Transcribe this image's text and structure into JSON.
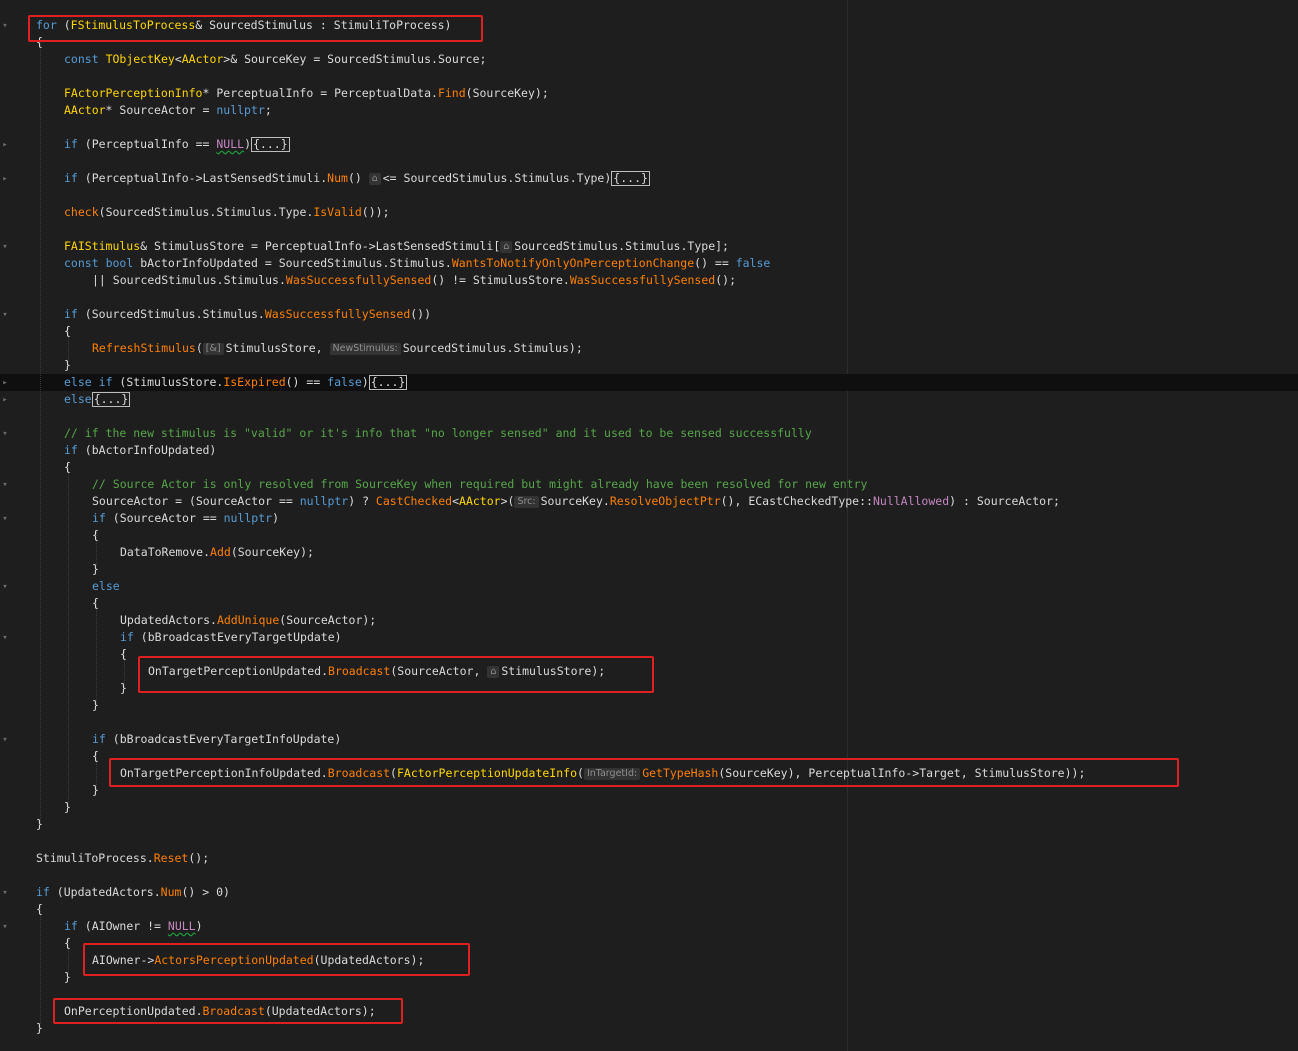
{
  "editor": {
    "language": "cpp",
    "hint_glyph": "⌂",
    "collapsed_block": "{...}"
  },
  "code": {
    "l1": [
      "for",
      " (",
      "FStimulusToProcess",
      "& ",
      "SourcedStimulus",
      " : ",
      "StimuliToProcess",
      ")"
    ],
    "l2": "{",
    "l3": [
      "const",
      " ",
      "TObjectKey",
      "<",
      "AActor",
      ">& ",
      "SourceKey",
      " = ",
      "SourcedStimulus",
      ".",
      "Source",
      ";"
    ],
    "l4": [
      "FActorPerceptionInfo",
      "* ",
      "PerceptualInfo",
      " = ",
      "PerceptualData",
      ".",
      "Find",
      "(",
      "SourceKey",
      ");"
    ],
    "l5": [
      "AActor",
      "* ",
      "SourceActor",
      " = ",
      "nullptr",
      ";"
    ],
    "l6": [
      "if",
      " (",
      "PerceptualInfo",
      " == ",
      "NULL",
      ")"
    ],
    "l7": [
      "if",
      " (",
      "PerceptualInfo",
      "->",
      "LastSensedStimuli",
      ".",
      "Num",
      "() ",
      "<= ",
      "SourcedStimulus",
      ".",
      "Stimulus",
      ".",
      "Type",
      ")"
    ],
    "l8": [
      "check",
      "(",
      "SourcedStimulus",
      ".",
      "Stimulus",
      ".",
      "Type",
      ".",
      "IsValid",
      "());"
    ],
    "l9": [
      "FAIStimulus",
      "& ",
      "StimulusStore",
      " = ",
      "PerceptualInfo",
      "->",
      "LastSensedStimuli",
      "[",
      "SourcedStimulus",
      ".",
      "Stimulus",
      ".",
      "Type",
      "];"
    ],
    "l10": [
      "const",
      " ",
      "bool",
      " ",
      "bActorInfoUpdated",
      " = ",
      "SourcedStimulus",
      ".",
      "Stimulus",
      ".",
      "WantsToNotifyOnlyOnPerceptionChange",
      "() == ",
      "false"
    ],
    "l11": [
      "|| ",
      "SourcedStimulus",
      ".",
      "Stimulus",
      ".",
      "WasSuccessfullySensed",
      "() != ",
      "StimulusStore",
      ".",
      "WasSuccessfullySensed",
      "();"
    ],
    "l12": [
      "if",
      " (",
      "SourcedStimulus",
      ".",
      "Stimulus",
      ".",
      "WasSuccessfullySensed",
      "())"
    ],
    "l13": "{",
    "l14": [
      "RefreshStimulus",
      "(",
      "[&]",
      "StimulusStore",
      ", ",
      "NewStimulus:",
      "SourcedStimulus",
      ".",
      "Stimulus",
      ");"
    ],
    "l15": "}",
    "l16": [
      "else",
      " ",
      "if",
      " (",
      "StimulusStore",
      ".",
      "IsExpired",
      "() == ",
      "false",
      ")"
    ],
    "l17": [
      "else"
    ],
    "l18": "// if the new stimulus is \"valid\" or it's info that \"no longer sensed\" and it used to be sensed successfully",
    "l19": [
      "if",
      " (",
      "bActorInfoUpdated",
      ")"
    ],
    "l20": "{",
    "l21": "// Source Actor is only resolved from SourceKey when required but might already have been resolved for new entry",
    "l22": [
      "SourceActor",
      " = (",
      "SourceActor",
      " == ",
      "nullptr",
      ") ? ",
      "CastChecked",
      "<",
      "AActor",
      ">(",
      "Src:",
      "SourceKey",
      ".",
      "ResolveObjectPtr",
      "(), ",
      "ECastCheckedType",
      "::",
      "NullAllowed",
      ") : ",
      "SourceActor",
      ";"
    ],
    "l23": [
      "if",
      " (",
      "SourceActor",
      " == ",
      "nullptr",
      ")"
    ],
    "l24": "{",
    "l25": [
      "DataToRemove",
      ".",
      "Add",
      "(",
      "SourceKey",
      ");"
    ],
    "l26": "}",
    "l27": "else",
    "l28": "{",
    "l29": [
      "UpdatedActors",
      ".",
      "AddUnique",
      "(",
      "SourceActor",
      ");"
    ],
    "l30": [
      "if",
      " (",
      "bBroadcastEveryTargetUpdate",
      ")"
    ],
    "l31": "{",
    "l32": [
      "OnTargetPerceptionUpdated",
      ".",
      "Broadcast",
      "(",
      "SourceActor",
      ", ",
      "StimulusStore",
      ");"
    ],
    "l33": "}",
    "l34": "}",
    "l35": [
      "if",
      " (",
      "bBroadcastEveryTargetInfoUpdate",
      ")"
    ],
    "l36": "{",
    "l37": [
      "OnTargetPerceptionInfoUpdated",
      ".",
      "Broadcast",
      "(",
      "FActorPerceptionUpdateInfo",
      "(",
      "InTargetId:",
      "GetTypeHash",
      "(",
      "SourceKey",
      "), ",
      "PerceptualInfo",
      "->",
      "Target",
      ", ",
      "StimulusStore",
      "));"
    ],
    "l38": "}",
    "l39": "}",
    "l40": "}",
    "l41": [
      "StimuliToProcess",
      ".",
      "Reset",
      "();"
    ],
    "l42": [
      "if",
      " (",
      "UpdatedActors",
      ".",
      "Num",
      "() > ",
      "0",
      ")"
    ],
    "l43": "{",
    "l44": [
      "if",
      " (",
      "AIOwner",
      " != ",
      "NULL",
      ")"
    ],
    "l45": "{",
    "l46": [
      "AIOwner",
      "->",
      "ActorsPerceptionUpdated",
      "(",
      "UpdatedActors",
      ");"
    ],
    "l47": "}",
    "l48": [
      "OnPerceptionUpdated",
      ".",
      "Broadcast",
      "(",
      "UpdatedActors",
      ");"
    ],
    "l49": "}"
  },
  "colors": {
    "background": "#1e1e1e",
    "keyword": "#569cd6",
    "type": "#ffd700",
    "function": "#ff8000",
    "comment": "#57a64a",
    "macro": "#c586c0",
    "highlight_box": "#e02020"
  }
}
